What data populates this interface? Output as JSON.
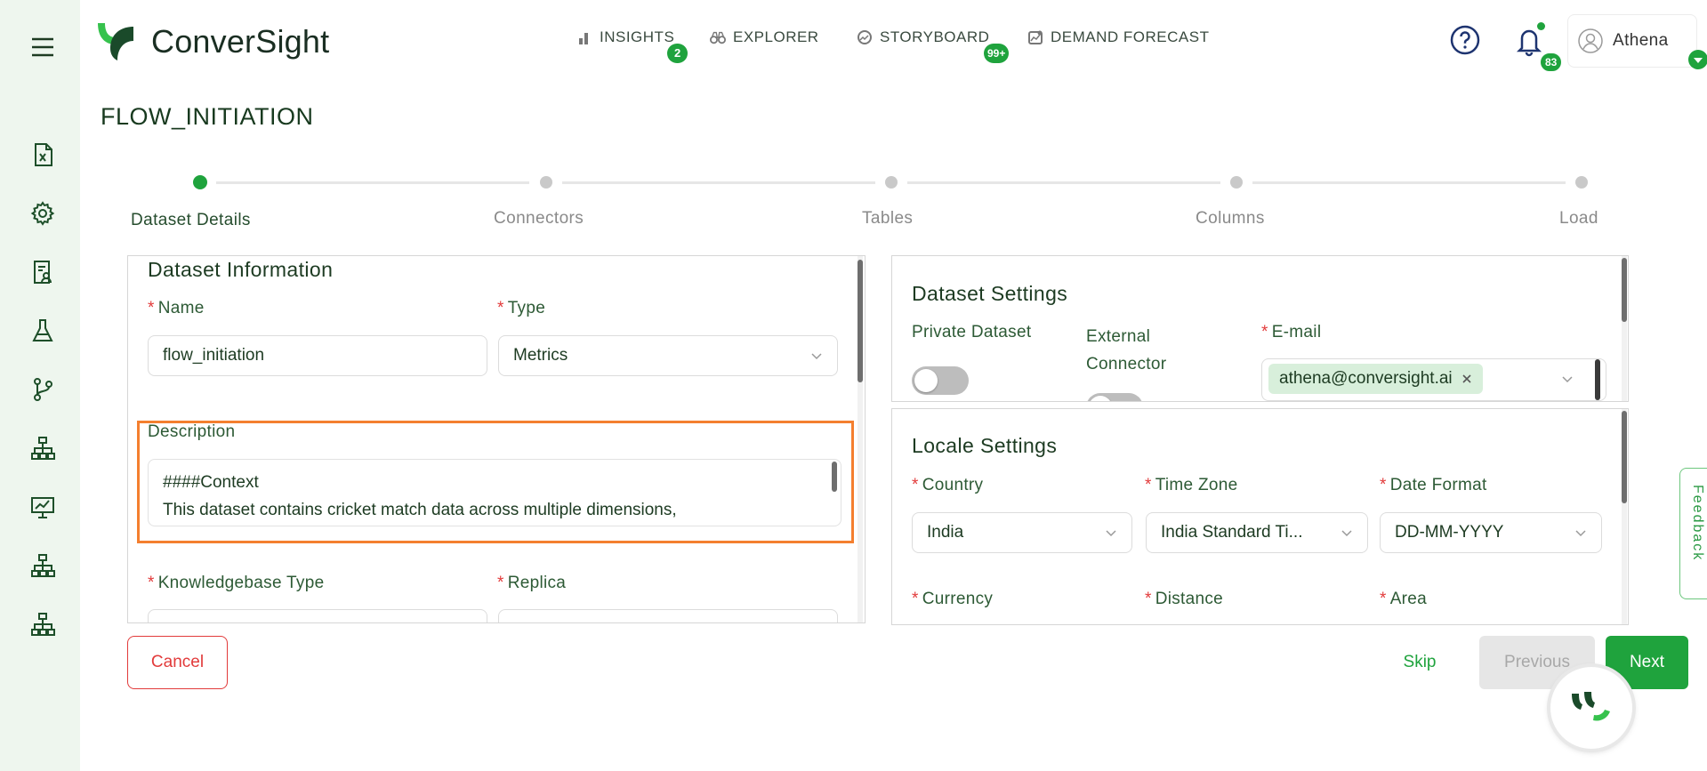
{
  "app": {
    "brand": "ConverSight",
    "accent": "#1fa33d",
    "highlight": "#f47f2f"
  },
  "sidebar": {
    "items": [
      {
        "icon": "menu-icon"
      },
      {
        "icon": "excel-file-icon"
      },
      {
        "icon": "gear-icon"
      },
      {
        "icon": "report-user-icon"
      },
      {
        "icon": "flask-icon"
      },
      {
        "icon": "branch-icon"
      },
      {
        "icon": "hierarchy-icon"
      },
      {
        "icon": "presentation-chart-icon"
      },
      {
        "icon": "hierarchy-icon"
      },
      {
        "icon": "hierarchy-icon"
      }
    ]
  },
  "header": {
    "nav": [
      {
        "label": "INSIGHTS",
        "icon": "bar-chart-icon",
        "badge": "2"
      },
      {
        "label": "EXPLORER",
        "icon": "binoculars-icon"
      },
      {
        "label": "STORYBOARD",
        "icon": "storyboard-icon",
        "badge": "99+"
      },
      {
        "label": "DEMAND FORECAST",
        "icon": "forecast-icon"
      }
    ],
    "help_icon": "help-circle-icon",
    "notification_count": "83",
    "user_name": "Athena"
  },
  "page": {
    "title": "FLOW_INITIATION"
  },
  "stepper": {
    "steps": [
      "Dataset Details",
      "Connectors",
      "Tables",
      "Columns",
      "Load"
    ],
    "active_index": 0
  },
  "dataset_info": {
    "title": "Dataset Information",
    "name_label": "Name",
    "name_value": "flow_initiation",
    "type_label": "Type",
    "type_value": "Metrics",
    "description_label": "Description",
    "description_line1": "####Context",
    "description_line2": "This dataset contains cricket match data across multiple dimensions,",
    "kb_type_label": "Knowledgebase Type",
    "replica_label": "Replica"
  },
  "dataset_settings": {
    "title": "Dataset Settings",
    "private_label": "Private Dataset",
    "external_label": "External Connector",
    "email_label": "E-mail",
    "email_chip": "athena@conversight.ai",
    "private_on": false
  },
  "locale_settings": {
    "title": "Locale Settings",
    "country_label": "Country",
    "country_value": "India",
    "timezone_label": "Time Zone",
    "timezone_value": "India Standard Ti...",
    "date_format_label": "Date Format",
    "date_format_value": "DD-MM-YYYY",
    "currency_label": "Currency",
    "distance_label": "Distance",
    "area_label": "Area"
  },
  "footer": {
    "cancel": "Cancel",
    "skip": "Skip",
    "previous": "Previous",
    "next": "Next"
  },
  "feedback_label": "Feedback"
}
